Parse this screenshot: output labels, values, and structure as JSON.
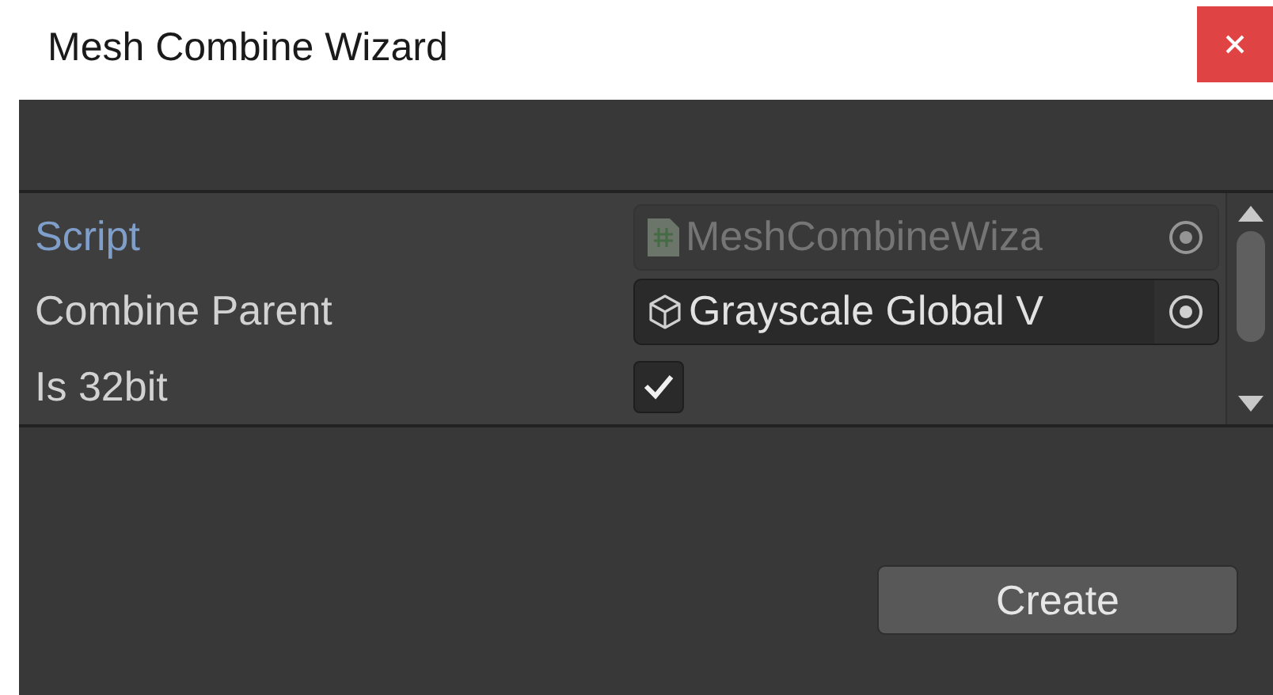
{
  "window": {
    "title": "Mesh Combine Wizard"
  },
  "fields": [
    {
      "kind": "script",
      "label": "Script",
      "value": "MeshCombineWiza",
      "disabled": true
    },
    {
      "kind": "object",
      "label": "Combine Parent",
      "value": "Grayscale Global V",
      "disabled": false
    },
    {
      "kind": "checkbox",
      "label": "Is 32bit",
      "checked": true,
      "disabled": false
    }
  ],
  "buttons": [
    {
      "label": "Create"
    }
  ]
}
